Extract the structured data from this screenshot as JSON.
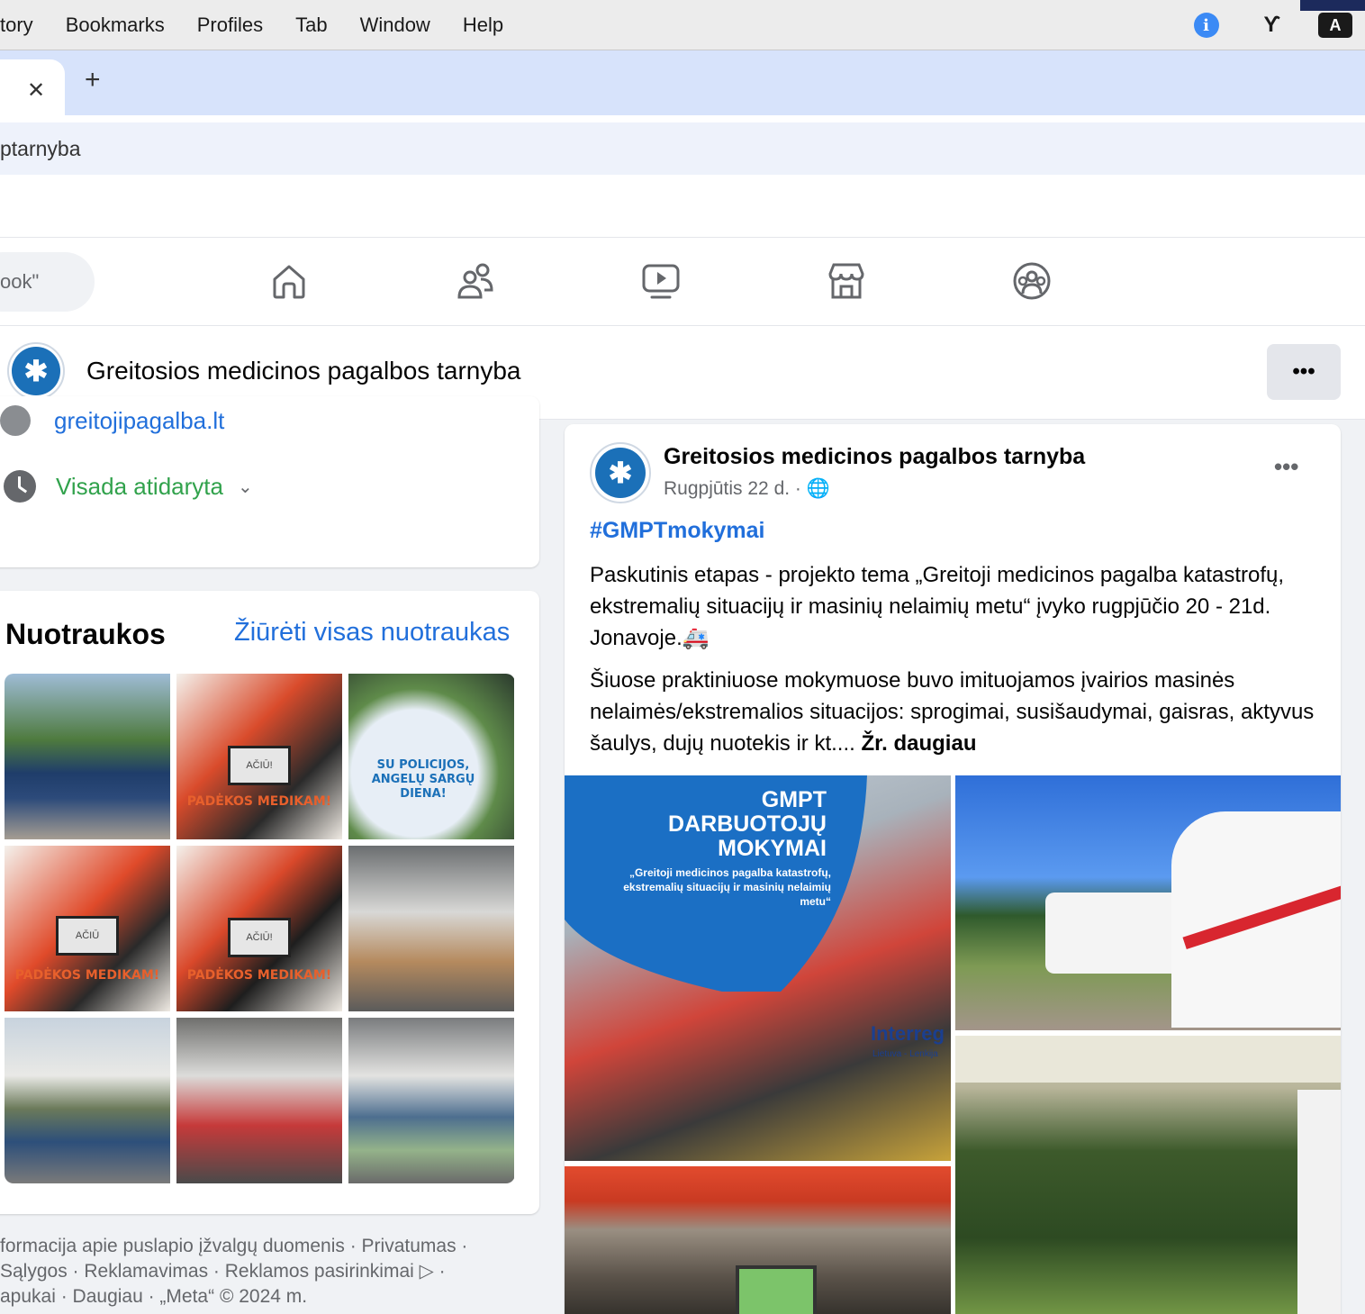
{
  "menubar": {
    "items": [
      "tory",
      "Bookmarks",
      "Profiles",
      "Tab",
      "Window",
      "Help"
    ],
    "info_glyph": "i",
    "tools_glyph": "ϒ",
    "input_source": "A"
  },
  "tabstrip": {
    "close_glyph": "✕",
    "new_glyph": "+"
  },
  "address": {
    "text": "ptarnyba"
  },
  "fbnav": {
    "search_placeholder": "ook\"",
    "icons": [
      "home-icon",
      "friends-icon",
      "video-icon",
      "marketplace-icon",
      "groups-icon"
    ]
  },
  "page": {
    "title": "Greitosios medicinos pagalbos tarnyba",
    "more_label": "•••"
  },
  "intro": {
    "website": "greitojipagalba.lt",
    "hours": "Visada atidaryta",
    "hours_chevron": "⌄"
  },
  "photos": {
    "title": "Nuotraukos",
    "see_all": "Žiūrėti visas nuotraukas",
    "tiles": [
      {
        "caption": ""
      },
      {
        "caption": "PADĖKOS MEDIKAM!",
        "sign": "AČIŪ!"
      },
      {
        "caption": "SU POLICIJOS, ANGELŲ SARGŲ DIENA!"
      },
      {
        "caption": "PADĖKOS MEDIKAM!",
        "sign": "AČIŪ"
      },
      {
        "caption": "PADĖKOS MEDIKAM!",
        "sign": "AČIŪ!"
      },
      {
        "caption": ""
      },
      {
        "caption": ""
      },
      {
        "caption": ""
      },
      {
        "caption": ""
      }
    ]
  },
  "footer": {
    "line1": "formacija apie puslapio įžvalgų duomenis · Privatumas ·",
    "line2": "Sąlygos · Reklamavimas · Reklamos pasirinkimai ▷ ·",
    "line3": "apukai · Daugiau · „Meta“ © 2024 m."
  },
  "post": {
    "author": "Greitosios medicinos pagalbos tarnyba",
    "date": "Rugpjūtis 22 d. · 🌐",
    "more": "•••",
    "hashtag": "#GMPTmokymai",
    "para1": "Paskutinis etapas - projekto tema „Greitoji medicinos pagalba katastrofų, ekstremalių situacijų ir masinių nelaimių metu“ įvyko rugpjūčio 20 - 21d. Jonavoje.🚑",
    "para2": "Šiuose praktiniuose mokymuose buvo imituojamos įvairios masinės nelaimės/ekstremalios situacijos: sprogimai, susišaudymai, gaisras, aktyvus šaulys, dujų nuotekis ir kt....",
    "see_more": "Žr. daugiau",
    "media_banner": {
      "line1": "GMPT",
      "line2": "DARBUOTOJŲ",
      "line3": "MOKYMAI",
      "sub": "„Greitoji medicinos pagalba katastrofų, ekstremalių situacijų ir masinių nelaimių metu“",
      "partner": "Interreg",
      "partner_sub": "Lietuva - Lenkija"
    }
  },
  "colors": {
    "fb_blue": "#216fdb",
    "green": "#31a24c",
    "tab_bg": "#d7e3fb",
    "gmpt_blue": "#1b70b8"
  }
}
